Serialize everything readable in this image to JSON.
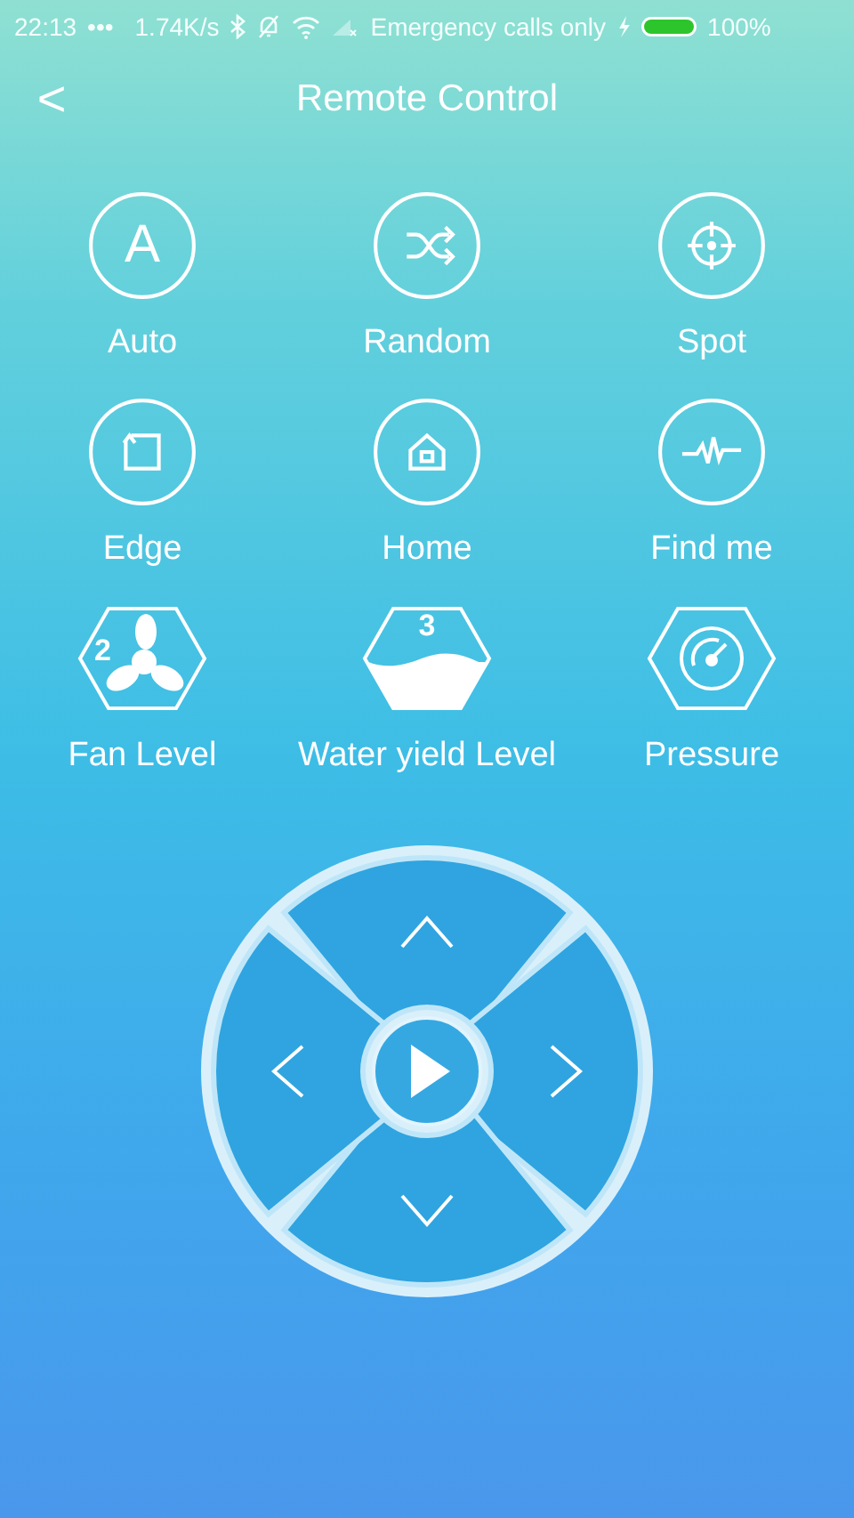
{
  "status_bar": {
    "time": "22:13",
    "dots": "•••",
    "speed": "1.74K/s",
    "carrier": "Emergency calls only",
    "battery": "100%"
  },
  "header": {
    "back": "<",
    "title": "Remote Control"
  },
  "modes": [
    {
      "kind": "auto",
      "label": "Auto",
      "glyph": "A"
    },
    {
      "kind": "random",
      "label": "Random"
    },
    {
      "kind": "spot",
      "label": "Spot"
    },
    {
      "kind": "edge",
      "label": "Edge"
    },
    {
      "kind": "home",
      "label": "Home"
    },
    {
      "kind": "findme",
      "label": "Find me"
    },
    {
      "kind": "fan",
      "label": "Fan Level",
      "badge": "2"
    },
    {
      "kind": "water",
      "label": "Water yield Level",
      "badge": "3"
    },
    {
      "kind": "pressure",
      "label": "Pressure"
    }
  ],
  "dpad": {
    "directions": [
      {
        "kind": "up"
      },
      {
        "kind": "right"
      },
      {
        "kind": "down"
      },
      {
        "kind": "left"
      }
    ]
  }
}
